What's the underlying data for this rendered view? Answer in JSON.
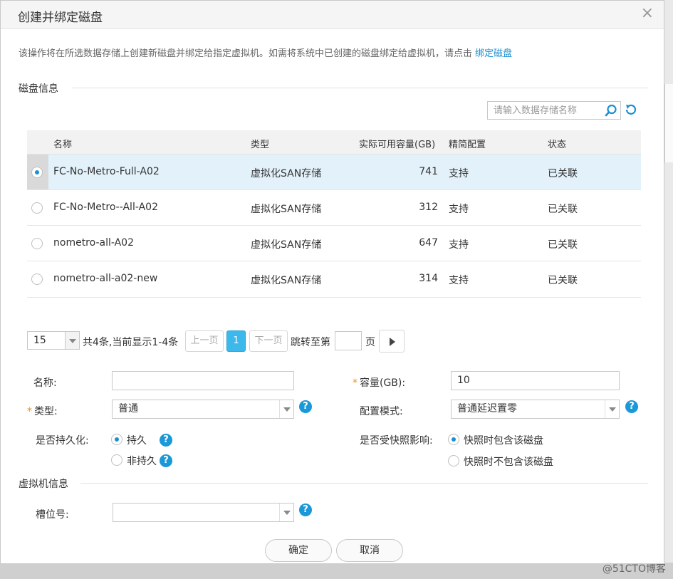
{
  "dialog": {
    "title": "创建并绑定磁盘",
    "close": "×",
    "notice": "该操作将在所选数据存储上创建新磁盘并绑定给指定虚拟机。如需将系统中已创建的磁盘绑定给虚拟机，请点击",
    "notice_link": "绑定磁盘"
  },
  "disk_section": {
    "title": "磁盘信息"
  },
  "search": {
    "placeholder": "请输入数据存储名称",
    "value": ""
  },
  "table": {
    "headers": [
      "名称",
      "类型",
      "实际可用容量(GB)",
      "精简配置",
      "状态"
    ],
    "rows": [
      {
        "name": "FC-No-Metro-Full-A02",
        "type": "虚拟化SAN存储",
        "capacity": "741",
        "thin": "支持",
        "status": "已关联",
        "selected": true
      },
      {
        "name": "FC-No-Metro--All-A02",
        "type": "虚拟化SAN存储",
        "capacity": "312",
        "thin": "支持",
        "status": "已关联",
        "selected": false
      },
      {
        "name": "nometro-all-A02",
        "type": "虚拟化SAN存储",
        "capacity": "647",
        "thin": "支持",
        "status": "已关联",
        "selected": false
      },
      {
        "name": "nometro-all-a02-new",
        "type": "虚拟化SAN存储",
        "capacity": "314",
        "thin": "支持",
        "status": "已关联",
        "selected": false
      }
    ]
  },
  "pager": {
    "page_size": "15",
    "summary": "共4条,当前显示1-4条",
    "prev": "上一页",
    "current": "1",
    "next": "下一页",
    "jump_label": "跳转至第",
    "page_unit": "页"
  },
  "form": {
    "name_label": "名称:",
    "name_value": "",
    "capacity_label": "容量(GB):",
    "capacity_value": "10",
    "type_label": "类型:",
    "type_value": "普通",
    "mode_label": "配置模式:",
    "mode_value": "普通延迟置零",
    "persist_label": "是否持久化:",
    "persist_opt1": "持久",
    "persist_opt2": "非持久",
    "snapshot_label": "是否受快照影响:",
    "snapshot_opt1": "快照时包含该磁盘",
    "snapshot_opt2": "快照时不包含该磁盘",
    "required_mark": "*"
  },
  "vm_section": {
    "title": "虚拟机信息",
    "slot_label": "槽位号:",
    "slot_value": ""
  },
  "buttons": {
    "ok": "确定",
    "cancel": "取消"
  },
  "watermark": "@51CTO博客",
  "colors": {
    "accent": "#1a8fd1",
    "page_current": "#3db8ea",
    "selected_row": "#e3f2fa",
    "required": "#f08c1e"
  },
  "icons": {
    "search": "search-icon",
    "refresh": "refresh-icon",
    "help": "help-icon",
    "close": "close-icon"
  }
}
